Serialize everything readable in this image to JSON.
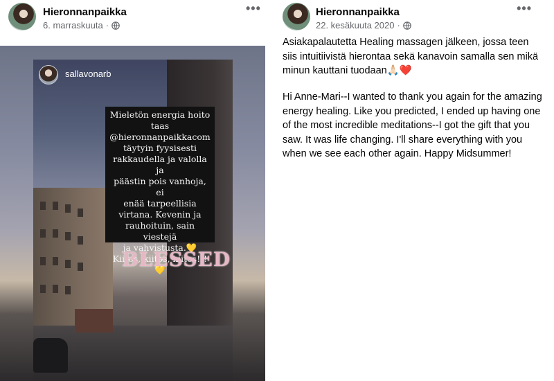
{
  "left_post": {
    "page_name": "Hieronnanpaikka",
    "date": "6. marraskuuta",
    "separator": "·",
    "more_label": "•••",
    "story": {
      "username": "sallavonarb",
      "caption": "Mieletön energia hoito\ntaas\n@hieronnanpaikkacom\ntäytyin fyysisesti\nrakkaudella ja valolla ja\npäästin pois vanhoja, ei\nenää tarpeellisia\nvirtana. Kevenin ja\nrauhoituin, sain viestejä\nja vahvistusta.💛\nKiitos, kiitos, kiitos!!!💛",
      "sticker": "BLESSED"
    }
  },
  "right_post": {
    "page_name": "Hieronnanpaikka",
    "date": "22. kesäkuuta 2020",
    "separator": "·",
    "more_label": "•••",
    "paragraph1": "Asiakapalautetta Healing massagen jälkeen,  jossa teen siis intuitiivistä hierontaa sekä kanavoin samalla sen mikä minun kauttani tuodaan🙏🏻❤️",
    "paragraph2": "Hi Anne-Mari--I wanted to thank you again for the amazing energy healing. Like you predicted, I ended up having one of the most incredible meditations--I got the gift that you saw. It was life changing. I'll share everything with you when we see each other again. Happy Midsummer!"
  },
  "icons": {
    "globe": "globe-icon",
    "more": "more-options-icon"
  }
}
